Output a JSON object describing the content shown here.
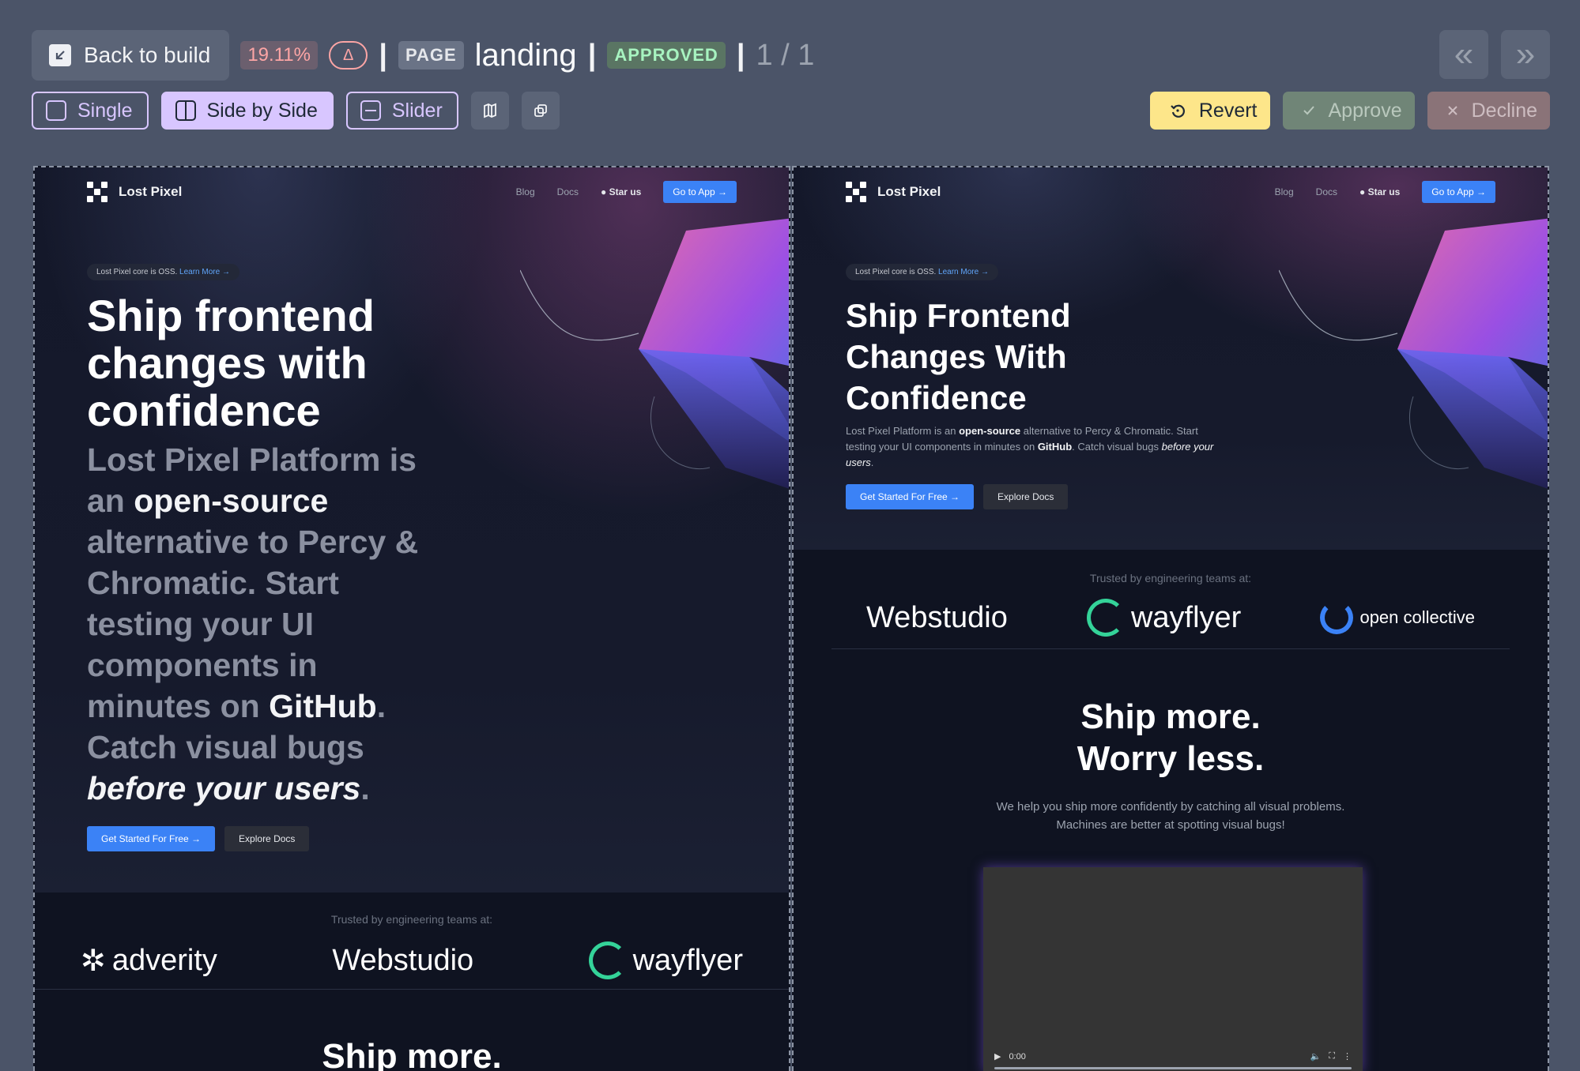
{
  "toolbar": {
    "back_label": "Back to build",
    "diff_percent": "19.11%",
    "delta_symbol": "Δ",
    "separator": "|",
    "type_badge": "PAGE",
    "page_name": "landing",
    "status_badge": "APPROVED",
    "pager": "1 / 1",
    "prev_glyph": "«",
    "next_glyph": "»",
    "modes": {
      "single": "Single",
      "side_by_side": "Side by Side",
      "slider": "Slider"
    },
    "active_mode": "Side by Side",
    "actions": {
      "revert": "Revert",
      "approve": "Approve",
      "decline": "Decline"
    }
  },
  "icons": [
    "back-arrow-icon",
    "map-icon",
    "copy-icon",
    "revert-icon",
    "check-icon",
    "close-icon",
    "github-icon"
  ],
  "colors": {
    "toolbar_bg": "#4b5468",
    "accent_purple": "#d8c6ff",
    "revert_yellow": "#fde68a",
    "diff_red": "#fca5a5",
    "approved_green": "#a7f3c0",
    "site_blue": "#3b82f6"
  },
  "left": {
    "nav": {
      "brand": "Lost Pixel",
      "blog": "Blog",
      "docs": "Docs",
      "star": "Star us",
      "go_app": "Go to App →"
    },
    "oss_text": "Lost Pixel core is OSS.",
    "oss_link": "Learn More →",
    "headline_l1": "Ship frontend",
    "headline_l2": "changes with",
    "headline_l3": "confidence",
    "lead_a": "Lost Pixel Platform is an",
    "lead_b": "open-source",
    "lead_c": "alternative to Percy & Chromatic. Start testing your UI components in minutes on",
    "lead_d": "GitHub",
    "lead_e": ". Catch visual bugs",
    "lead_f": "before your users",
    "lead_g": ".",
    "cta_primary": "Get Started For Free →",
    "cta_secondary": "Explore Docs",
    "trusted": "Trusted by engineering teams at:",
    "logos": [
      "adverity",
      "Webstudio",
      "wayflyer"
    ],
    "ship": "Ship more."
  },
  "right": {
    "nav": {
      "brand": "Lost Pixel",
      "blog": "Blog",
      "docs": "Docs",
      "star": "Star us",
      "go_app": "Go to App →"
    },
    "oss_text": "Lost Pixel core is OSS.",
    "oss_link": "Learn More →",
    "headline_l1": "Ship Frontend",
    "headline_l2": "Changes With",
    "headline_l3": "Confidence",
    "lead_a": "Lost Pixel Platform is an",
    "lead_b": "open-source",
    "lead_c": "alternative to Percy & Chromatic. Start testing your UI components in minutes on",
    "lead_d": "GitHub",
    "lead_e": ". Catch visual bugs",
    "lead_f": "before your users",
    "lead_g": ".",
    "cta_primary": "Get Started For Free →",
    "cta_secondary": "Explore Docs",
    "trusted": "Trusted by engineering teams at:",
    "logos": [
      "Webstudio",
      "wayflyer",
      "open collective"
    ],
    "ship_l1": "Ship more.",
    "ship_l2": "Worry less.",
    "help_l1": "We help you ship more confidently by catching all visual problems.",
    "help_l2": "Machines are better at spotting visual bugs!",
    "video_time": "0:00"
  }
}
